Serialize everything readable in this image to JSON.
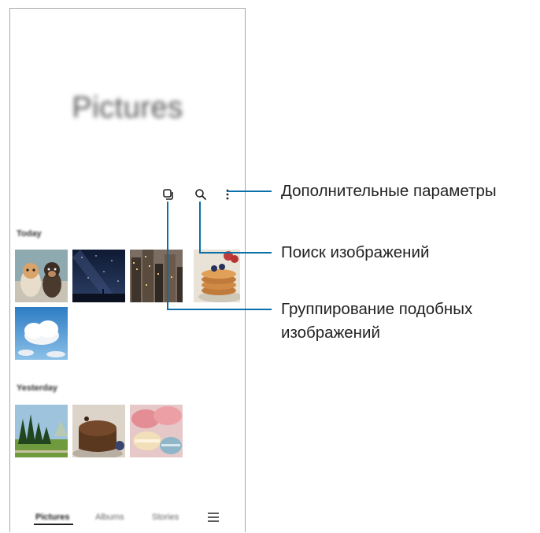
{
  "app": {
    "title": "Pictures",
    "sections": [
      {
        "label": "Today"
      },
      {
        "label": "Yesterday"
      }
    ],
    "toolbar": {
      "group_icon": "group-similar-icon",
      "search_icon": "search-icon",
      "more_icon": "more-options-icon"
    },
    "nav": {
      "tabs": [
        {
          "label": "Pictures"
        },
        {
          "label": "Albums"
        },
        {
          "label": "Stories"
        }
      ],
      "menu_icon": "menu-icon"
    }
  },
  "callouts": {
    "more_options": "Дополнительные параметры",
    "search": "Поиск изображений",
    "group_similar_line1": "Группирование подобных",
    "group_similar_line2": "изображений"
  },
  "colors": {
    "accent_line": "#0a6fa8",
    "frame": "#a8a8a8"
  }
}
